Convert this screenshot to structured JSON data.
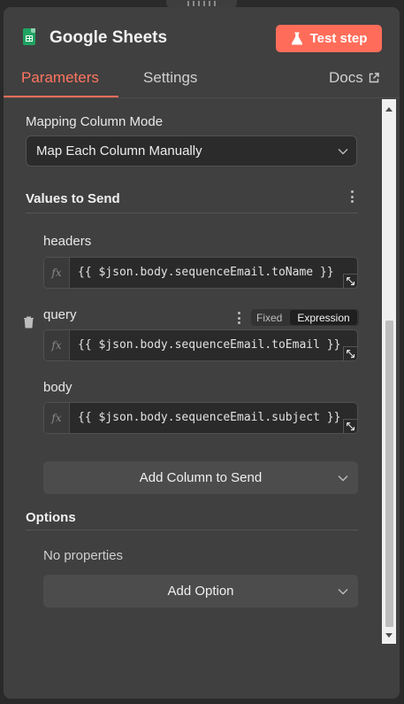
{
  "node": {
    "title": "Google Sheets",
    "icon": "google-sheets-icon",
    "test_step_label": "Test step",
    "accent_color": "#ff6d5a"
  },
  "tabs": {
    "parameters": "Parameters",
    "settings": "Settings",
    "docs": "Docs"
  },
  "mapping": {
    "label": "Mapping Column Mode",
    "selected": "Map Each Column Manually"
  },
  "values_to_send": {
    "title": "Values to Send",
    "fields": [
      {
        "label": "headers",
        "value": "{{ $json.body.sequenceEmail.toName }}"
      },
      {
        "label": "query",
        "value": "{{ $json.body.sequenceEmail.toEmail }}"
      },
      {
        "label": "body",
        "value": "{{ $json.body.sequenceEmail.subject }}"
      }
    ],
    "mode_fixed": "Fixed",
    "mode_expression": "Expression",
    "add_column_label": "Add Column to Send"
  },
  "options": {
    "title": "Options",
    "empty_text": "No properties",
    "add_option_label": "Add Option"
  }
}
